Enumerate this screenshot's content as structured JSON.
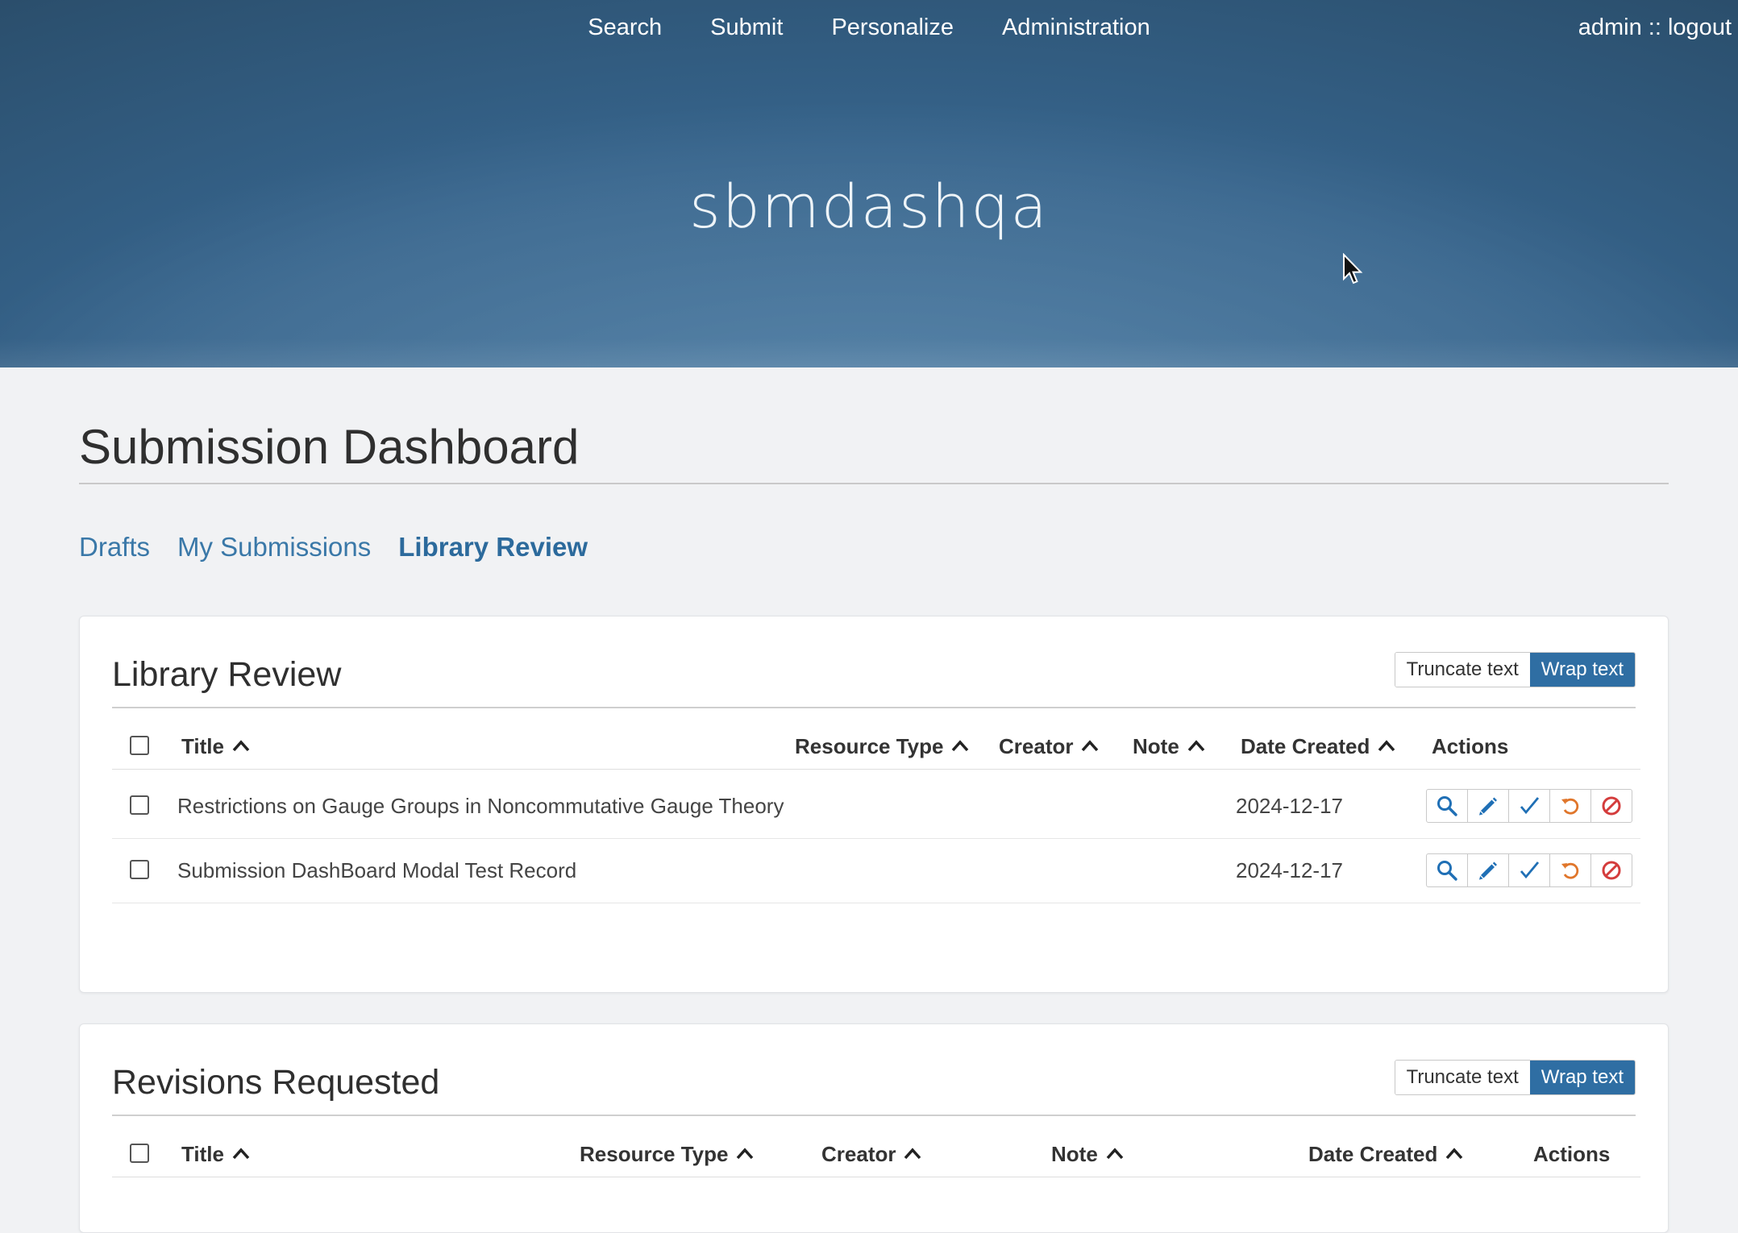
{
  "nav": {
    "items": [
      "Search",
      "Submit",
      "Personalize",
      "Administration"
    ],
    "user": "admin",
    "separator": "::",
    "logout": "logout"
  },
  "site_title": "sbmdashqa",
  "page": {
    "heading": "Submission Dashboard",
    "tabs": [
      {
        "label": "Drafts",
        "active": false
      },
      {
        "label": "My Submissions",
        "active": false
      },
      {
        "label": "Library Review",
        "active": true
      }
    ]
  },
  "colors": {
    "accent": "#2f6ea3",
    "link": "#3a78a8",
    "view_icon": "#1f6fb5",
    "edit_icon": "#1f6fb5",
    "approve_icon": "#1f6fb5",
    "return_icon": "#e0762b",
    "reject_icon": "#d43c3c"
  },
  "library_review": {
    "title": "Library Review",
    "truncate_label": "Truncate text",
    "wrap_label": "Wrap text",
    "columns": [
      "Title",
      "Resource Type",
      "Creator",
      "Note",
      "Date Created",
      "Actions"
    ],
    "rows": [
      {
        "title": "Restrictions on Gauge Groups in Noncommutative Gauge Theory",
        "resource_type": "",
        "creator": "",
        "note": "",
        "date_created": "2024-12-17"
      },
      {
        "title": "Submission DashBoard Modal Test Record",
        "resource_type": "",
        "creator": "",
        "note": "",
        "date_created": "2024-12-17"
      }
    ],
    "action_icons": [
      "search-icon",
      "pencil-icon",
      "checkmark-icon",
      "undo-icon",
      "ban-icon"
    ]
  },
  "revisions_requested": {
    "title": "Revisions Requested",
    "truncate_label": "Truncate text",
    "wrap_label": "Wrap text",
    "columns": [
      "Title",
      "Resource Type",
      "Creator",
      "Note",
      "Date Created",
      "Actions"
    ]
  }
}
